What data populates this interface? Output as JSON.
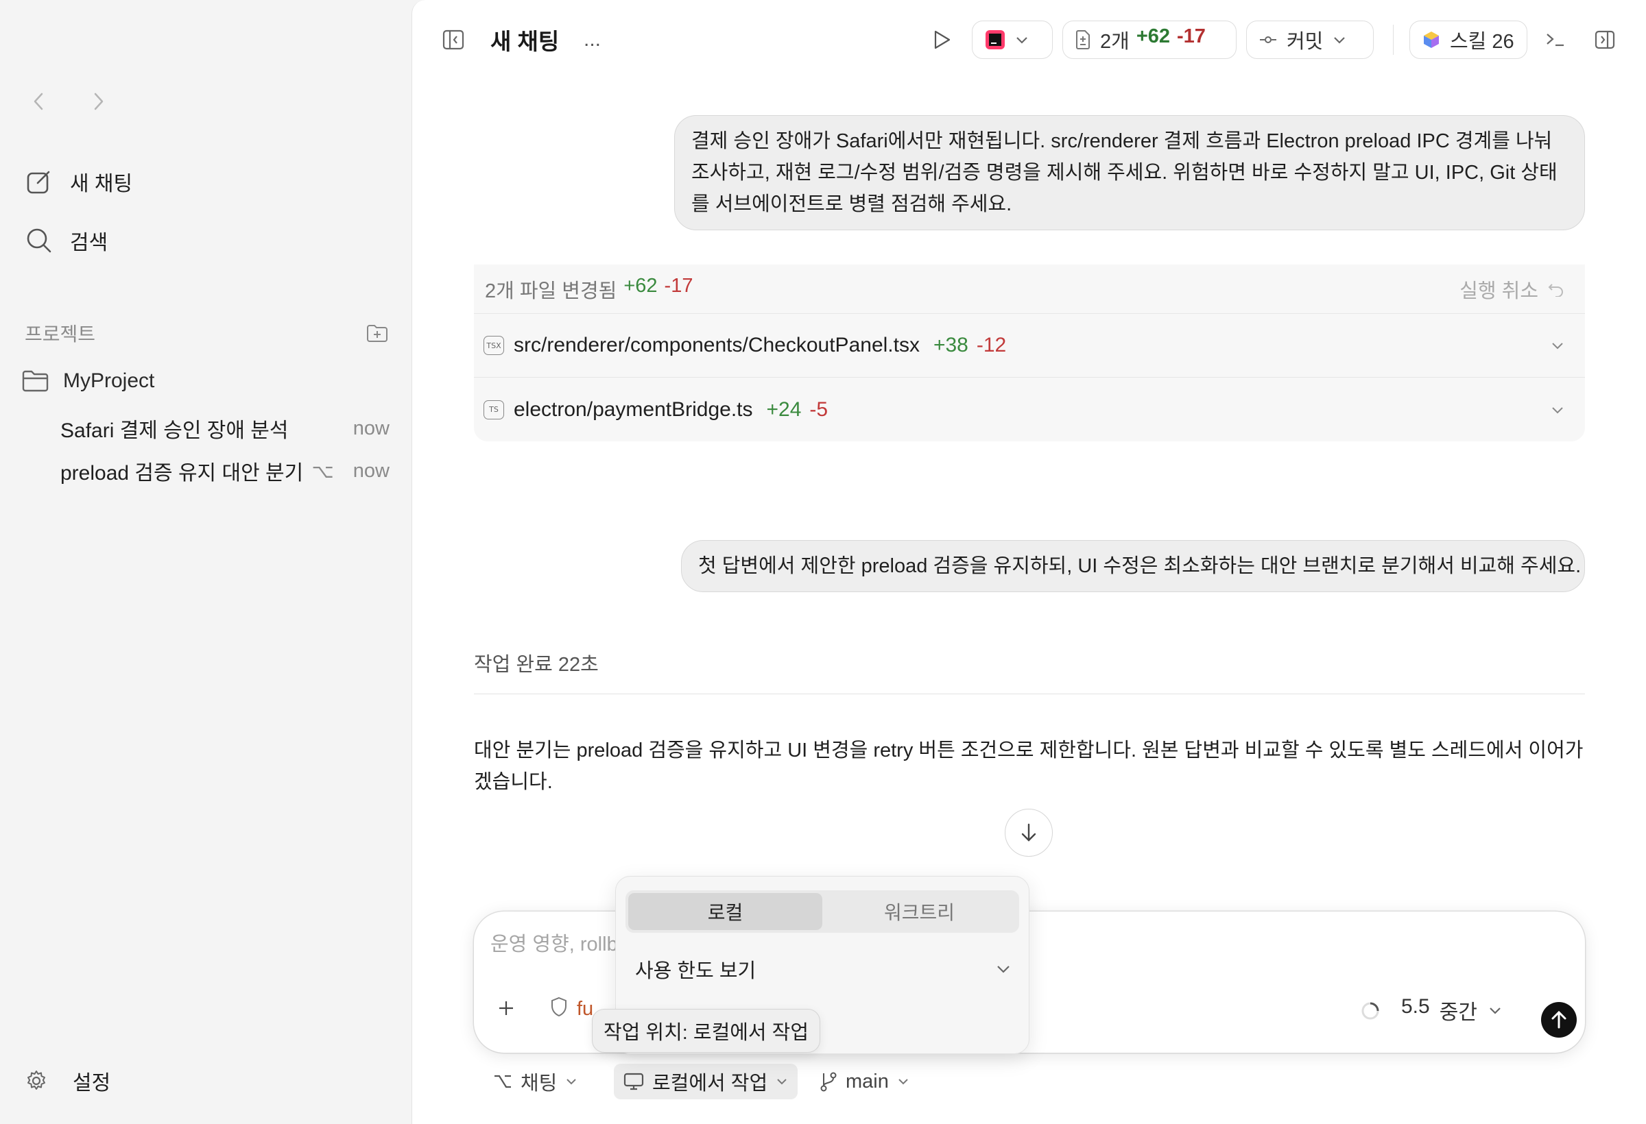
{
  "sidebar": {
    "new_chat": "새 채팅",
    "search": "검색",
    "projects_label": "프로젝트",
    "project_name": "MyProject",
    "threads": [
      {
        "title": "Safari 결제 승인 장애 분석",
        "branch": "",
        "time": "now"
      },
      {
        "title": "preload 검증 유지 대안 분기",
        "branch": "⌥",
        "time": "now"
      }
    ],
    "settings": "설정"
  },
  "header": {
    "title": "새 채팅",
    "more": "...",
    "diff_files": "2개",
    "diff_add": "+62",
    "diff_del": "-17",
    "commit_label": "커밋",
    "skills_label": "스킬 26"
  },
  "messages": {
    "user_1": "결제 승인 장애가 Safari에서만 재현됩니다. src/renderer 결제 흐름과 Electron preload IPC 경계를 나눠 조사하고, 재현 로그/수정 범위/검증 명령을 제시해 주세요. 위험하면 바로 수정하지 말고 UI, IPC, Git 상태를 서브에이전트로 병렬 점검해 주세요.",
    "user_2": "첫 답변에서 제안한 preload 검증을 유지하되, UI 수정은 최소화하는 대안 브랜치로 분기해서 비교해 주세요.",
    "status": "작업 완료 22초",
    "answer": "대안 분기는 preload 검증을 유지하고 UI 변경을 retry 버튼 조건으로 제한합니다. 원본 답변과 비교할 수 있도록 별도 스레드에서 이어가겠습니다."
  },
  "changes": {
    "summary": "2개 파일 변경됨",
    "add": "+62",
    "del": "-17",
    "undo": "실행 취소",
    "files": [
      {
        "badge": "TSX",
        "name": "src/renderer/components/CheckoutPanel.tsx",
        "add": "+38",
        "del": "-12"
      },
      {
        "badge": "TS",
        "name": "electron/paymentBridge.ts",
        "add": "+24",
        "del": "-5"
      }
    ]
  },
  "composer": {
    "placeholder": "운영 영향, rollb",
    "perm_text": "fu",
    "model": "5.5",
    "effort": "중간"
  },
  "popover": {
    "tab_local": "로컬",
    "tab_worktree": "워크트리",
    "usage": "사용 한도 보기"
  },
  "tooltip": "작업 위치: 로컬에서 작업",
  "bottom": {
    "mode": "채팅",
    "location": "로컬에서 작업",
    "branch": "main"
  },
  "colors": {
    "add_green": "#3a8a3e",
    "del_red": "#c23a3a",
    "send_button": "#111111"
  }
}
